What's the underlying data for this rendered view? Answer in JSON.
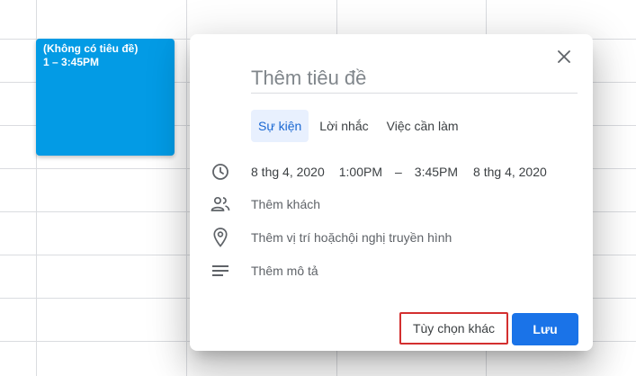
{
  "calendar": {
    "event_chip": {
      "title": "(Không có tiêu đề)",
      "time": "1 – 3:45PM",
      "color": "#039be5"
    }
  },
  "dialog": {
    "close_icon": "close-icon",
    "title_placeholder": "Thêm tiêu đề",
    "tabs": [
      {
        "label": "Sự kiện",
        "active": true
      },
      {
        "label": "Lời nhắc",
        "active": false
      },
      {
        "label": "Việc cần làm",
        "active": false
      }
    ],
    "datetime": {
      "start_date": "8 thg 4, 2020",
      "start_time": "1:00PM",
      "separator": "–",
      "end_time": "3:45PM",
      "end_date": "8 thg 4, 2020"
    },
    "guests_label": "Thêm khách",
    "location_label": "Thêm vị trí hoặchội nghị truyền hình",
    "description_label": "Thêm mô tả",
    "more_options_label": "Tùy chọn khác",
    "save_label": "Lưu",
    "accent_color": "#1a73e8",
    "highlight_color": "#d32f2f"
  }
}
